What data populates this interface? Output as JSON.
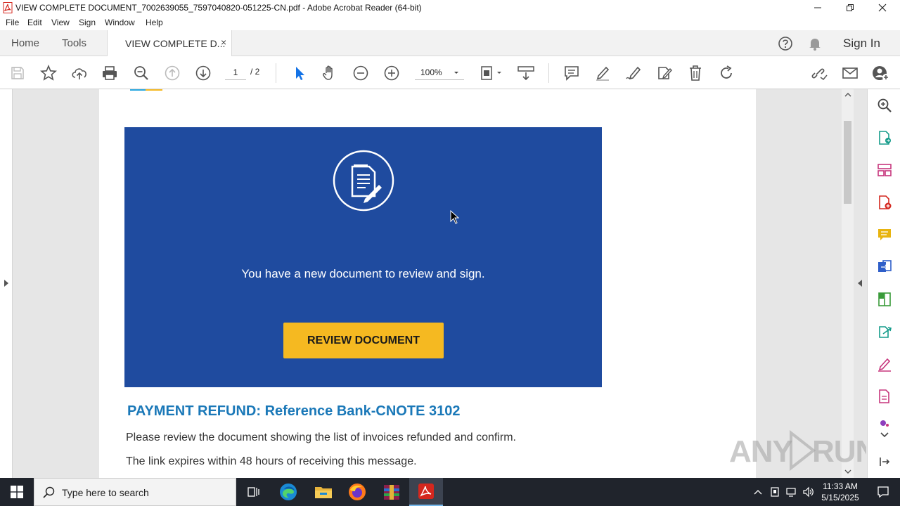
{
  "window": {
    "title": "VIEW COMPLETE DOCUMENT_7002639055_7597040820-051225-CN.pdf - Adobe Acrobat Reader (64-bit)"
  },
  "menu": [
    "File",
    "Edit",
    "View",
    "Sign",
    "Window",
    "Help"
  ],
  "tabs": {
    "home": "Home",
    "tools": "Tools",
    "document": "VIEW COMPLETE D...",
    "close": "×",
    "sign_in": "Sign In"
  },
  "toolbar": {
    "page_current": "1",
    "page_total": "/ 2",
    "zoom": "100%"
  },
  "document": {
    "banner_message": "You have a new document to review and sign.",
    "review_button": "REVIEW DOCUMENT",
    "heading": "PAYMENT REFUND: Reference Bank-CNOTE 3102",
    "paragraph_1": "Please review the document showing the list of invoices refunded and confirm.",
    "paragraph_2": "The link expires within 48 hours of receiving this message."
  },
  "watermark": "ANY RUN",
  "taskbar": {
    "search_placeholder": "Type here to search",
    "time": "11:33 AM",
    "date": "5/15/2025"
  },
  "colors": {
    "banner": "#1f4b9f",
    "button": "#f5b921",
    "heading": "#1a78b8",
    "acrobat_red": "#d4271e"
  }
}
